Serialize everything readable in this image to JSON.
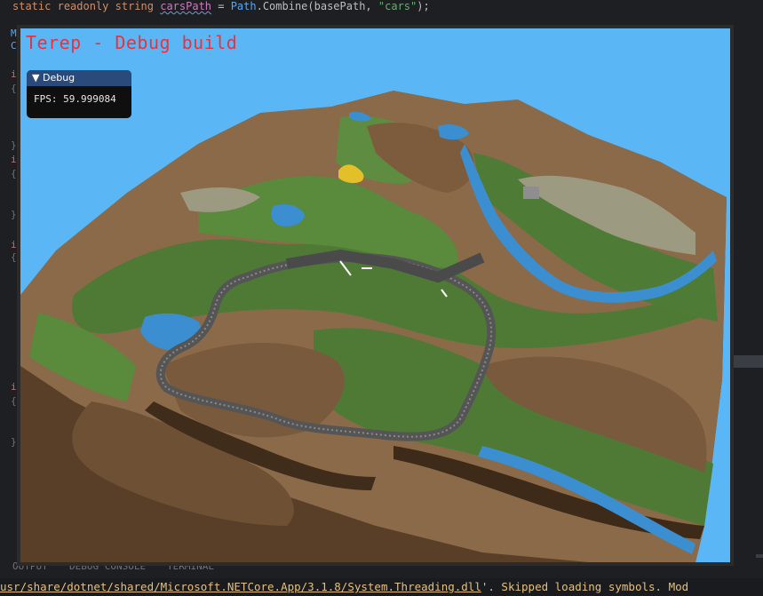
{
  "editor": {
    "code_line": {
      "kw1": "static",
      "kw2": "readonly",
      "kw3": "string",
      "var": "carsPath",
      "op": " = ",
      "cls": "Path",
      "method": ".Combine(basePath, ",
      "str": "\"cars\"",
      "end": ");"
    },
    "gutter_marks": [
      "M",
      "C",
      "i",
      "{",
      "}",
      "i",
      "{",
      "}",
      "i",
      "{",
      "i",
      "{",
      "}"
    ]
  },
  "bottom_panel": {
    "tabs": [
      "OUTPUT",
      "DEBUG CONSOLE",
      "TERMINAL"
    ]
  },
  "status_bar": {
    "path_prefix": "usr/share/dotnet/shared/Microsoft.NETCore.App/3.1.8/System.Threading.dll",
    "suffix": "'. Skipped loading symbols. Mod"
  },
  "game": {
    "title": "Terep - Debug build",
    "debug_panel": {
      "header": "Debug",
      "fps_label": "FPS:",
      "fps_value": "59.999084"
    }
  },
  "colors": {
    "sky": "#5bb6f5",
    "title_red": "#e8323f",
    "panel_header": "#294a7a"
  }
}
